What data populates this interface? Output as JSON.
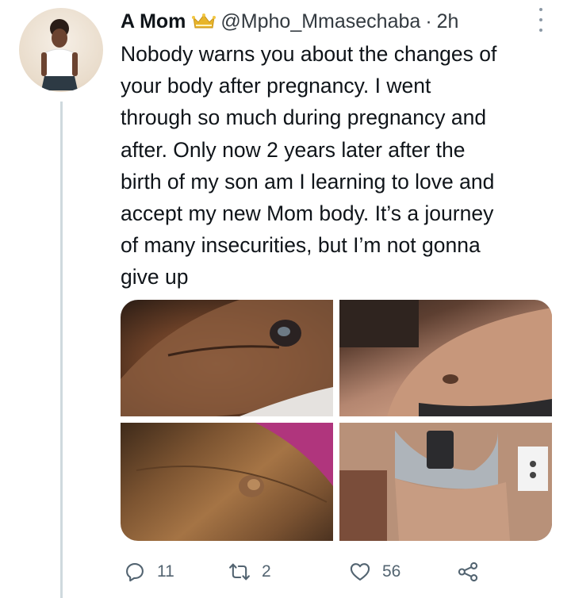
{
  "tweet": {
    "display_name": "A Mom",
    "badge_icon": "crown-emoji-icon",
    "handle": "@Mpho_Mmasechaba",
    "separator": "·",
    "time": "2h",
    "text": "Nobody warns you about the changes of\nyour body after pregnancy. I went\nthrough so much during pregnancy and\nafter. Only now 2 years later after the\nbirth of my son am I learning to love and\naccept my new Mom body. It’s a journey\nof many insecurities, but I’m not gonna\ngive up",
    "media": [
      {
        "name": "photo-1",
        "description": ""
      },
      {
        "name": "photo-2",
        "description": ""
      },
      {
        "name": "photo-3",
        "description": ""
      },
      {
        "name": "photo-4",
        "description": ""
      }
    ]
  },
  "actions": {
    "reply": {
      "icon": "reply-icon",
      "count": "11"
    },
    "retweet": {
      "icon": "retweet-icon",
      "count": "2"
    },
    "like": {
      "icon": "heart-icon",
      "count": "56"
    },
    "share": {
      "icon": "share-icon"
    }
  },
  "colors": {
    "text": "#0f1419",
    "secondary": "#536471",
    "thread_line": "#cfd9de",
    "crown": "#e8b52a"
  }
}
